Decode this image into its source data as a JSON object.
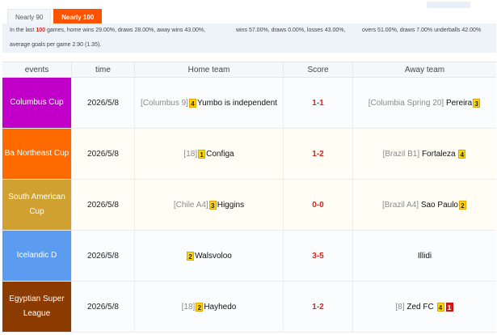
{
  "tabs": [
    {
      "label": "Nearly 90",
      "active": false
    },
    {
      "label": "Nearly 100",
      "active": true
    }
  ],
  "stats": {
    "prefix": "In the last",
    "count": "100",
    "line1": "games, home wins 29.00%, draws 28.00%, away wins 43.00%,",
    "line1b": "wins 57.00%, draws 0.00%, losses 43.00%,",
    "line1c": "overs 51.00%, draws 7.00% underballs 42.00%",
    "line2": "average    goals per game 2.90 (1.35)."
  },
  "table": {
    "headers": [
      "events",
      "time",
      "Home team",
      "Score",
      "Away team"
    ],
    "rows": [
      {
        "event": "Columbus Cup",
        "event_color": "#c000c8",
        "time": "2026/5/8",
        "home_rank": "[Columbus 9]",
        "home_badge": "4",
        "home_name": "Yumbo is independent",
        "score": "1-1",
        "away_rank": "[Columbia Spring 20]",
        "away_name": "Pereira",
        "away_badge": "3"
      },
      {
        "event": "Ba Northeast Cup",
        "event_color": "#ff6a00",
        "time": "2026/5/8",
        "home_rank": "[18]",
        "home_badge": "1",
        "home_name": "Configa",
        "score": "1-2",
        "away_rank": "[Brazil B1]",
        "away_name": "Fortaleza",
        "away_badge": "4"
      },
      {
        "event": "South American Cup",
        "event_color": "#d0a030",
        "time": "2026/5/8",
        "home_rank": "[Chile A4]",
        "home_badge": "3",
        "home_name": "Higgins",
        "score": "0-0",
        "away_rank": "[Brazil A4]",
        "away_name": "Sao Paulo",
        "away_badge": "2"
      },
      {
        "event": "Icelandic D",
        "event_color": "#5b9bf0",
        "time": "2026/5/8",
        "home_rank": "",
        "home_badge": "2",
        "home_name": "Walsvoloo",
        "score": "3-5",
        "away_rank": "",
        "away_name": "Illidi",
        "away_badge": ""
      },
      {
        "event": "Egyptian Super League",
        "event_color": "#8b3b00",
        "time": "2026/5/8",
        "home_rank": "[18]",
        "home_badge": "2",
        "home_name": "Hayhedo",
        "score": "1-2",
        "away_rank": "[8]",
        "away_name": "Zed FC",
        "away_badge": "4",
        "away_badge_red": "1"
      }
    ]
  }
}
